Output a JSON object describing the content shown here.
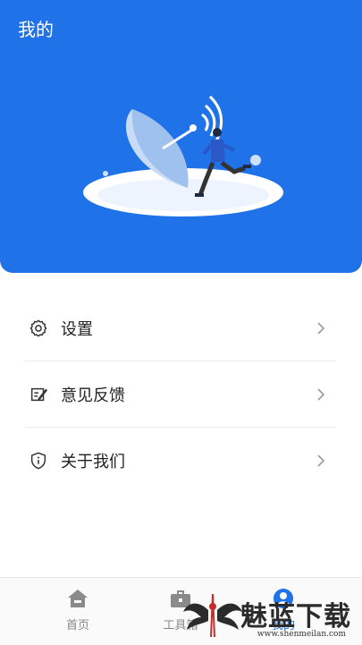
{
  "header": {
    "title": "我的"
  },
  "menu": {
    "items": [
      {
        "label": "设置",
        "icon": "gear-icon"
      },
      {
        "label": "意见反馈",
        "icon": "feedback-icon"
      },
      {
        "label": "关于我们",
        "icon": "info-shield-icon"
      }
    ]
  },
  "tabbar": {
    "tabs": [
      {
        "label": "首页",
        "icon": "home-icon"
      },
      {
        "label": "工具箱",
        "icon": "toolbox-icon"
      },
      {
        "label": "我的",
        "icon": "profile-icon",
        "active": true
      }
    ]
  },
  "watermark": {
    "text": "魅蓝下载",
    "url": "www.shenmeilan.com"
  },
  "colors": {
    "primary": "#1f72e8",
    "text": "#222222",
    "muted": "#888888"
  }
}
